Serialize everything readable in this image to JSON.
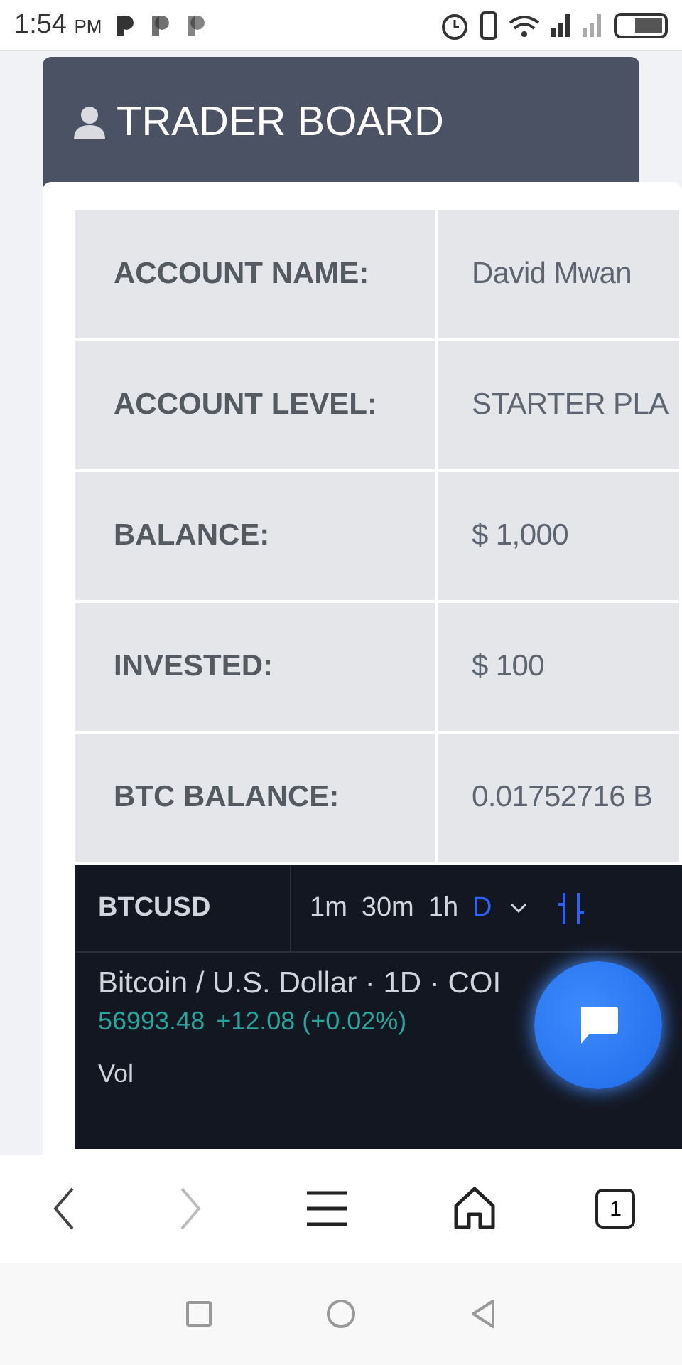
{
  "status_bar": {
    "time": "1:54",
    "period": "PM"
  },
  "header": {
    "title": "TRADER BOARD"
  },
  "account_rows": [
    {
      "label": "ACCOUNT NAME:",
      "value": "David Mwan"
    },
    {
      "label": "ACCOUNT LEVEL:",
      "value": "STARTER PLA"
    },
    {
      "label": "BALANCE:",
      "value": "$ 1,000"
    },
    {
      "label": "INVESTED:",
      "value": "$ 100"
    },
    {
      "label": "BTC BALANCE:",
      "value": "0.01752716 B"
    }
  ],
  "chart_widget": {
    "symbol": "BTCUSD",
    "intervals": [
      {
        "label": "1m",
        "selected": false
      },
      {
        "label": "30m",
        "selected": false
      },
      {
        "label": "1h",
        "selected": false
      },
      {
        "label": "D",
        "selected": true
      }
    ],
    "title": "Bitcoin / U.S. Dollar · 1D · COI",
    "price": "56993.48",
    "change": "+12.08 (+0.02%)",
    "volume_label": "Vol"
  },
  "browser_bar": {
    "forward_disabled": true,
    "tab_count": "1"
  }
}
